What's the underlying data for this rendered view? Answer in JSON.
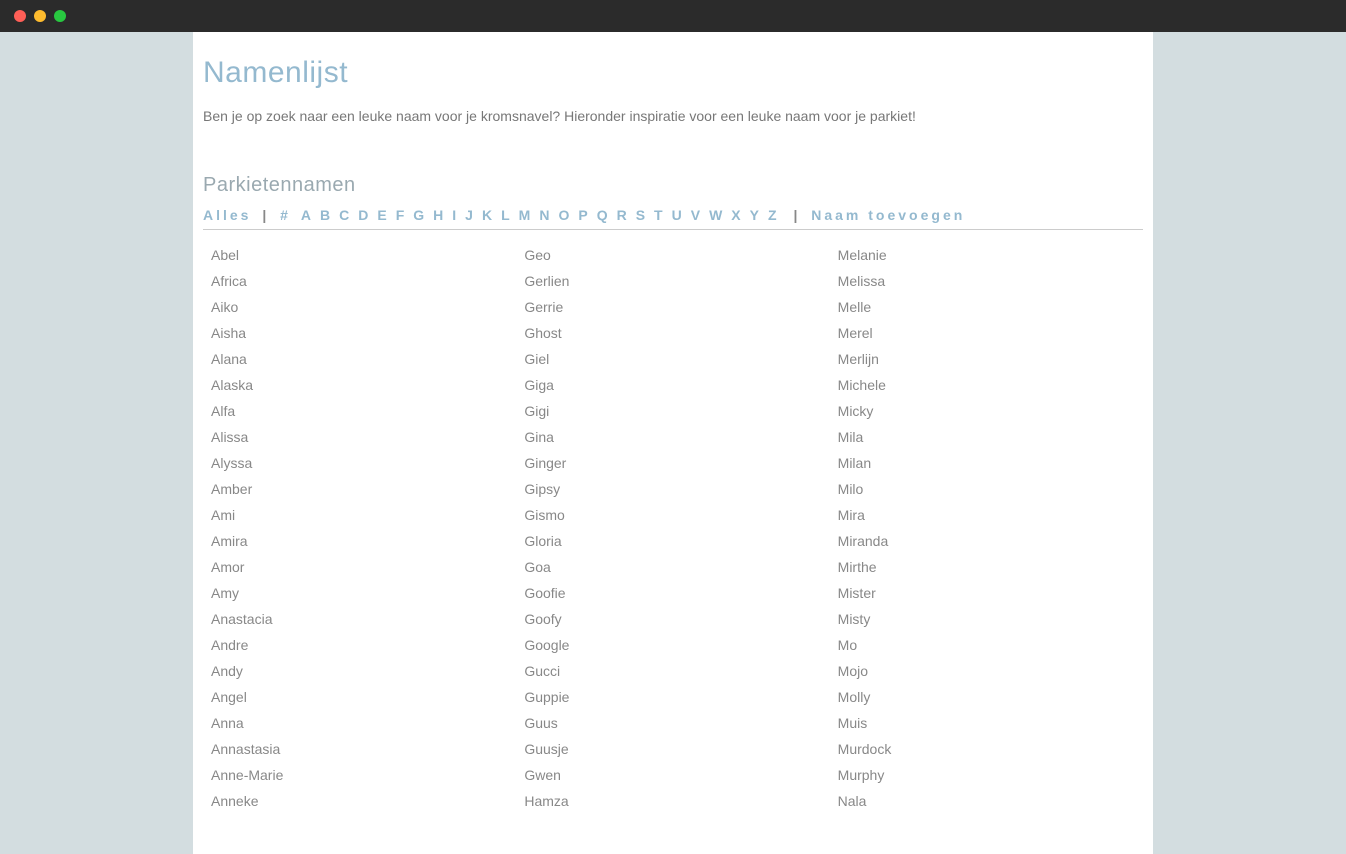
{
  "page": {
    "title": "Namenlijst",
    "intro": "Ben je op zoek naar een leuke naam voor je kromsnavel? Hieronder inspiratie voor een leuke naam voor je parkiet!",
    "section_title": "Parkietennamen"
  },
  "filter": {
    "all": "Alles",
    "hash": "#",
    "letters": [
      "A",
      "B",
      "C",
      "D",
      "E",
      "F",
      "G",
      "H",
      "I",
      "J",
      "K",
      "L",
      "M",
      "N",
      "O",
      "P",
      "Q",
      "R",
      "S",
      "T",
      "U",
      "V",
      "W",
      "X",
      "Y",
      "Z"
    ],
    "add": "Naam toevoegen"
  },
  "names": {
    "col1": [
      "Abel",
      "Africa",
      "Aiko",
      "Aisha",
      "Alana",
      "Alaska",
      "Alfa",
      "Alissa",
      "Alyssa",
      "Amber",
      "Ami",
      "Amira",
      "Amor",
      "Amy",
      "Anastacia",
      "Andre",
      "Andy",
      "Angel",
      "Anna",
      "Annastasia",
      "Anne-Marie",
      "Anneke"
    ],
    "col2": [
      "Geo",
      "Gerlien",
      "Gerrie",
      "Ghost",
      "Giel",
      "Giga",
      "Gigi",
      "Gina",
      "Ginger",
      "Gipsy",
      "Gismo",
      "Gloria",
      "Goa",
      "Goofie",
      "Goofy",
      "Google",
      "Gucci",
      "Guppie",
      "Guus",
      "Guusje",
      "Gwen",
      "Hamza"
    ],
    "col3": [
      "Melanie",
      "Melissa",
      "Melle",
      "Merel",
      "Merlijn",
      "Michele",
      "Micky",
      "Mila",
      "Milan",
      "Milo",
      "Mira",
      "Miranda",
      "Mirthe",
      "Mister",
      "Misty",
      "Mo",
      "Mojo",
      "Molly",
      "Muis",
      "Murdock",
      "Murphy",
      "Nala"
    ]
  }
}
